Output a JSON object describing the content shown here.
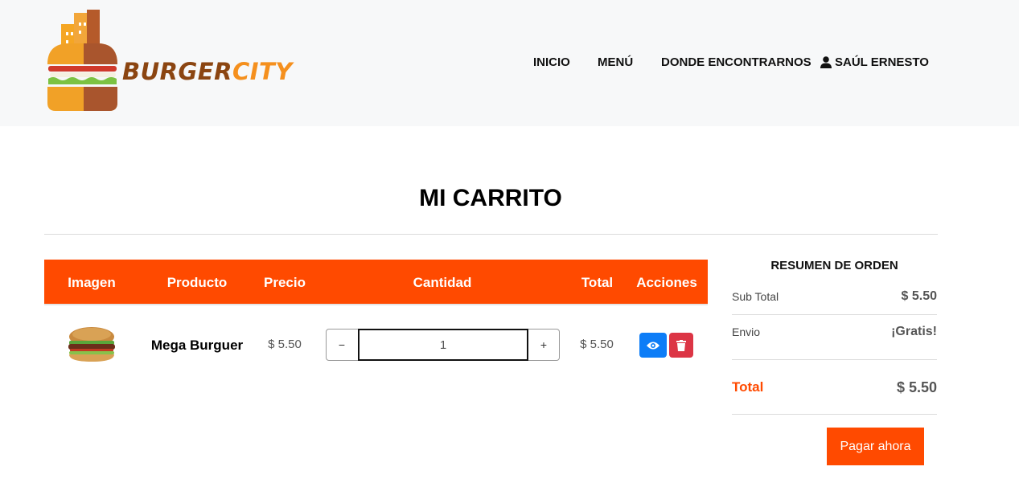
{
  "header": {
    "logo": {
      "brand_part1": "BURGER",
      "brand_part2": "CITY"
    },
    "nav": {
      "inicio": "INICIO",
      "menu": "MENÚ",
      "donde": "DONDE ENCONTRARNOS",
      "user": "SAÚL ERNESTO",
      "user_icon": "user-icon"
    }
  },
  "page": {
    "title": "MI CARRITO"
  },
  "cart_table": {
    "headers": {
      "imagen": "Imagen",
      "producto": "Producto",
      "precio": "Precio",
      "cantidad": "Cantidad",
      "total": "Total",
      "acciones": "Acciones"
    },
    "rows": [
      {
        "image_icon": "burger-image",
        "producto": "Mega Burguer",
        "precio": "$ 5.50",
        "cantidad": "1",
        "minus": "−",
        "plus": "+",
        "total": "$ 5.50",
        "view_icon": "eye-icon",
        "delete_icon": "trash-icon"
      }
    ]
  },
  "summary": {
    "title": "RESUMEN DE ORDEN",
    "subtotal_label": "Sub Total",
    "subtotal_value": "$ 5.50",
    "envio_label": "Envio",
    "envio_value": "¡Gratis!",
    "total_label": "Total",
    "total_value": "$ 5.50",
    "pay_button": "Pagar ahora"
  },
  "colors": {
    "accent": "#ff4a00",
    "header_bg": "#f7f8f9",
    "view_button": "#0d7df7",
    "delete_button": "#dc3545",
    "brand_brown": "#8b4511",
    "brand_orange": "#f5901e"
  }
}
